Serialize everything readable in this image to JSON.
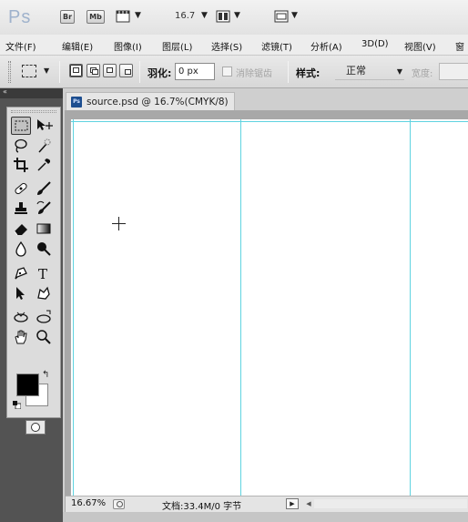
{
  "app": {
    "logo": "Ps",
    "bridge_label": "Br",
    "minibridge_label": "Mb",
    "zoom_value": "16.7"
  },
  "menu": {
    "items": [
      "文件(F)",
      "编辑(E)",
      "图像(I)",
      "图层(L)",
      "选择(S)",
      "滤镜(T)",
      "分析(A)",
      "3D(D)",
      "视图(V)",
      "窗"
    ]
  },
  "options": {
    "feather_label": "羽化:",
    "feather_value": "0 px",
    "antialias_label": "消除锯齿",
    "style_label": "样式:",
    "style_value": "正常",
    "width_label": "宽度:"
  },
  "tools_panel": {
    "collapse_icon": "«",
    "foreground_color": "#000000",
    "background_color": "#ffffff"
  },
  "document": {
    "tab_icon_label": "Ps",
    "title": "source.psd @ 16.7%(CMYK/8)"
  },
  "status": {
    "zoom": "16.67%",
    "doc_info": "文档:33.4M/0 字节"
  },
  "colors": {
    "guide": "#5fd3e0",
    "panel_bg": "#535353",
    "canvas": "#ffffff"
  }
}
